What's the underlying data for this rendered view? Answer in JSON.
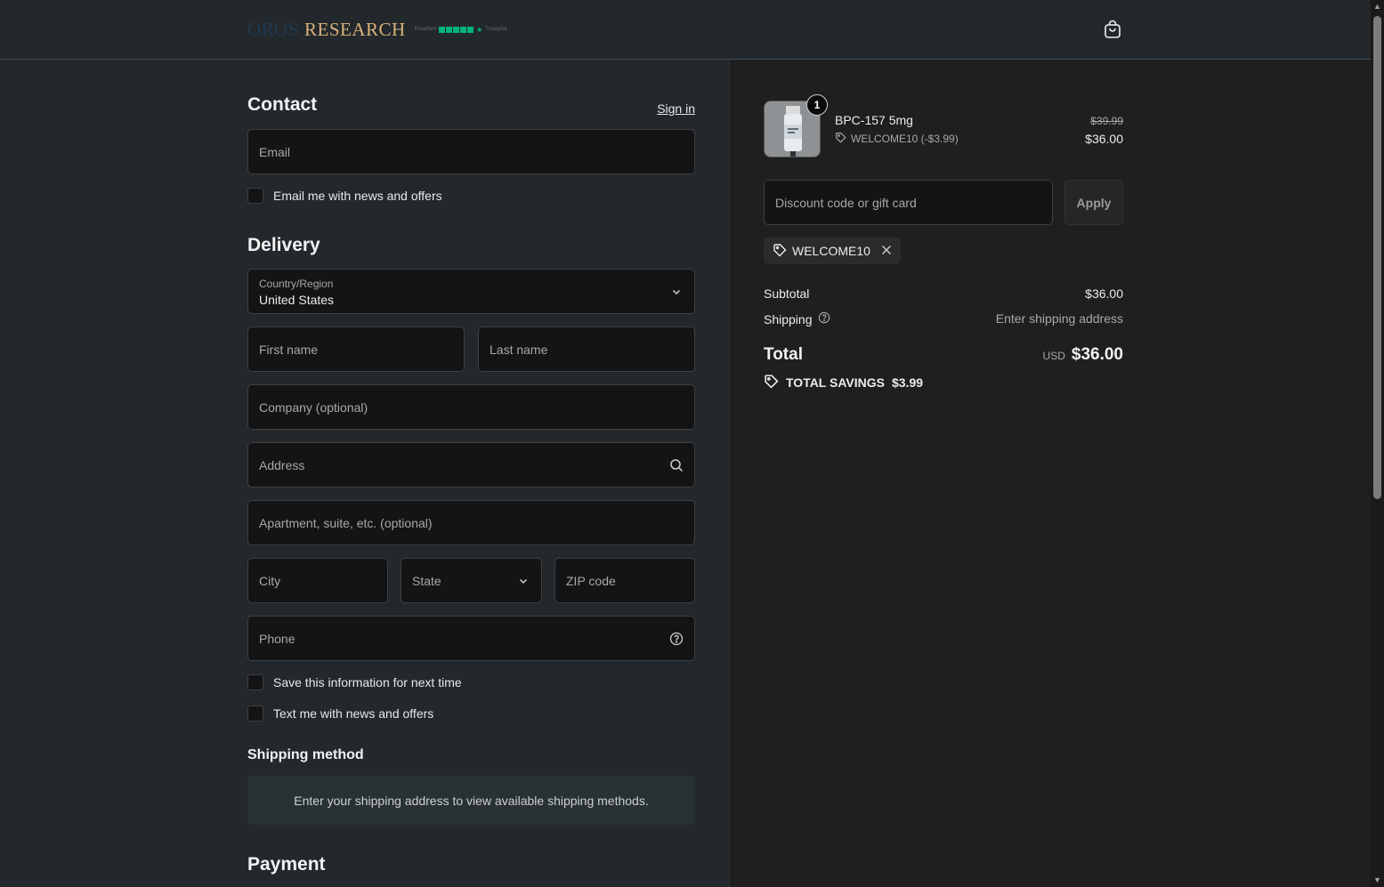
{
  "header": {
    "logo_word1": "OROS",
    "logo_word2": "RESEARCH",
    "trust_text_left": "Excellent",
    "trust_text_right": "Trustpilot",
    "cart_icon": "shopping-bag-icon"
  },
  "contact": {
    "title": "Contact",
    "sign_in": "Sign in",
    "email_placeholder": "Email",
    "email_optin": "Email me with news and offers"
  },
  "delivery": {
    "title": "Delivery",
    "country_label": "Country/Region",
    "country_value": "United States",
    "first_name": "First name",
    "last_name": "Last name",
    "company": "Company (optional)",
    "address": "Address",
    "apartment": "Apartment, suite, etc. (optional)",
    "city": "City",
    "state": "State",
    "zip": "ZIP code",
    "phone": "Phone",
    "save_info": "Save this information for next time",
    "text_optin": "Text me with news and offers"
  },
  "shipping_method": {
    "title": "Shipping method",
    "message": "Enter your shipping address to view available shipping methods."
  },
  "payment": {
    "title": "Payment"
  },
  "summary": {
    "product": {
      "qty": "1",
      "name": "BPC-157 5mg",
      "discount": "WELCOME10 (-$3.99)",
      "price_old": "$39.99",
      "price_new": "$36.00"
    },
    "discount_placeholder": "Discount code or gift card",
    "apply": "Apply",
    "applied_code": "WELCOME10",
    "subtotal_label": "Subtotal",
    "subtotal_value": "$36.00",
    "shipping_label": "Shipping",
    "shipping_value": "Enter shipping address",
    "total_label": "Total",
    "currency": "USD",
    "total_value": "$36.00",
    "savings_label": "TOTAL SAVINGS",
    "savings_value": "$3.99"
  },
  "colors": {
    "page_bg": "#23282c",
    "summary_bg": "#1f1f1f",
    "field_bg": "#141414",
    "logo_gold": "#d9b27a",
    "trust_green": "#00b67a"
  }
}
